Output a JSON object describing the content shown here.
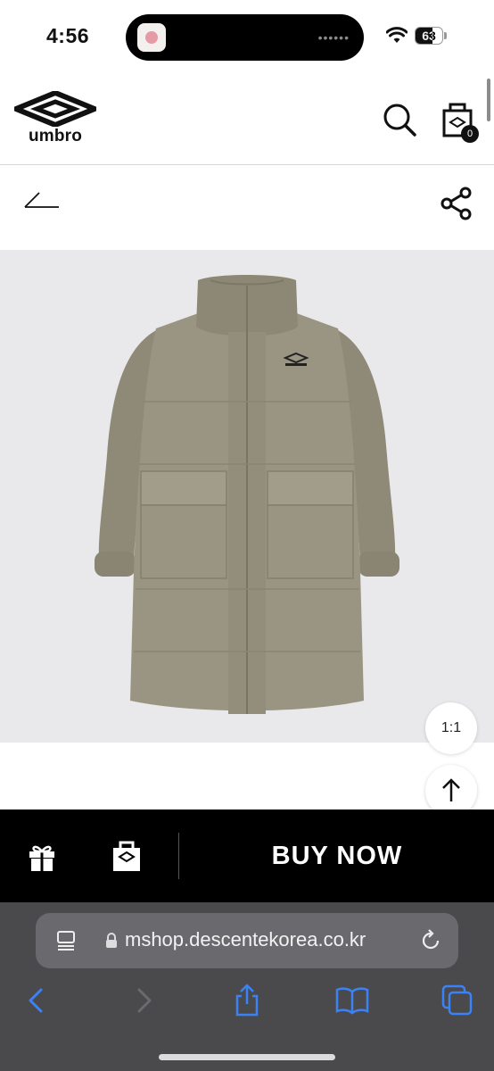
{
  "status_bar": {
    "time": "4:56",
    "battery": "63",
    "battery_level": 0.63
  },
  "header": {
    "brand": "umbro",
    "cart_count": "0"
  },
  "product": {
    "image_icon": "down-coat-image"
  },
  "controls": {
    "ratio_label": "1:1"
  },
  "action_bar": {
    "buy_label": "BUY NOW"
  },
  "safari": {
    "url": "mshop.descentekorea.co.kr"
  },
  "colors": {
    "coat": "#9a9483",
    "hero_bg": "#e9e9eb",
    "action_bar": "#000000",
    "safari_bg": "#4a4a4d",
    "safari_accent": "#3b82f6"
  }
}
